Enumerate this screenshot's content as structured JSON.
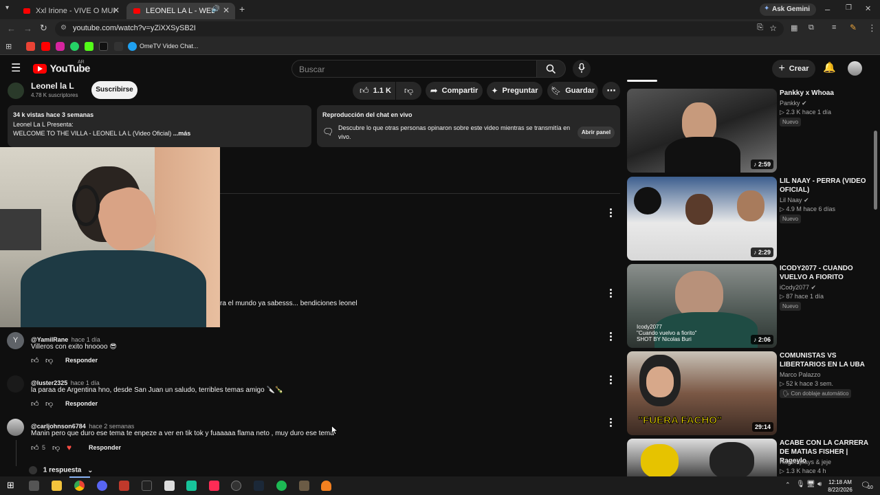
{
  "browser": {
    "tabs": [
      {
        "title": "Xxl Irione - VIVE O MUERE (Ofici"
      },
      {
        "title": "LEONEL LA L - WELCOME TO"
      }
    ],
    "ask_gemini": "Ask Gemini",
    "url": "youtube.com/watch?v=yZiXXSySB2I",
    "bookmark": "OmeTV Video Chat..."
  },
  "youtube": {
    "logo_text": "YouTube",
    "region": "AR",
    "search_placeholder": "Buscar",
    "create_label": "Crear"
  },
  "channel": {
    "name": "Leonel la L",
    "subs": "4.78 K suscriptores",
    "subscribe": "Suscribirse"
  },
  "actions": {
    "likes": "1.1 K",
    "share": "Compartir",
    "ask": "Preguntar",
    "save": "Guardar"
  },
  "description": {
    "stats": "34 k vistas  hace 3 semanas",
    "line1": "Leonel La L Presenta:",
    "line2": "WELCOME TO THE VILLA - LEONEL LA L (Video Oficial)",
    "more": "...más"
  },
  "chat_replay": {
    "title": "Reproducción del chat en vivo",
    "text": "Descubre lo que otras personas opinaron sobre este video mientras se transmitía en vivo.",
    "button": "Abrir panel"
  },
  "partial_comment": "ra el mundo ya sabesss... bendiciones leonel",
  "comments": [
    {
      "author": "@YamilRane",
      "time": "hace 1 día",
      "text": "Villeros con exito hnoooo 😎",
      "likes": "",
      "reply": "Responder",
      "avatar_letter": "Y"
    },
    {
      "author": "@luster2325",
      "time": "hace 1 día",
      "text": "la paraa de Argentina hno, desde San Juan un saludo, terribles temas amigo 🔪🍾",
      "likes": "",
      "reply": "Responder",
      "avatar_letter": ""
    },
    {
      "author": "@carljohnson6784",
      "time": "hace 2 semanas",
      "text": "Manin pero que duro ese tema te enpeze a ver en tik tok y fuaaaaa flama neto , muy duro ese tema",
      "likes": "5",
      "reply": "Responder",
      "avatar_letter": ""
    }
  ],
  "replies_toggle": "1 respuesta",
  "related": [
    {
      "title": "Pankky x Whoaa",
      "channel": "Pankky",
      "meta": "2.3 K  hace 1 día",
      "badge": "Nuevo",
      "duration": "2:59",
      "color": "#3a3a3a"
    },
    {
      "title": "LIL NAAY - PERRA (VIDEO OFICIAL)",
      "channel": "Lil Naay",
      "meta": "4.9 M  hace 6 días",
      "badge": "Nuevo",
      "duration": "2:29",
      "color": "#2d4f7a"
    },
    {
      "title": "ICODY2077 - CUANDO VUELVO A FIORITO",
      "channel": "iCody2077",
      "meta": "87  hace 1 día",
      "badge": "Nuevo",
      "duration": "2:06",
      "color": "#505a55",
      "overlay": "Icody2077\n\"Cuando vuelvo a fiorito\"\nSHOT BY Nicolas Buri"
    },
    {
      "title": "COMUNISTAS VS LIBERTARIOS EN LA UBA",
      "channel": "Marco Palazzo",
      "meta": "52 k  hace 3 sem.",
      "badge": "Con doblaje automático",
      "duration": "29:14",
      "color": "#6b4a3a",
      "overlay": "\"FUERA FACHO\""
    },
    {
      "title": "ACABE CON LA CARRERA DE MATIAS FISHER | Rageylo",
      "channel": "Ragemplays & jeje",
      "meta": "1.3 K  hace 4 h",
      "badge": "",
      "duration": "",
      "color": "#444"
    }
  ],
  "taskbar": {
    "time": "12:18 AM",
    "date": "8/22/2026",
    "notif": "10"
  }
}
